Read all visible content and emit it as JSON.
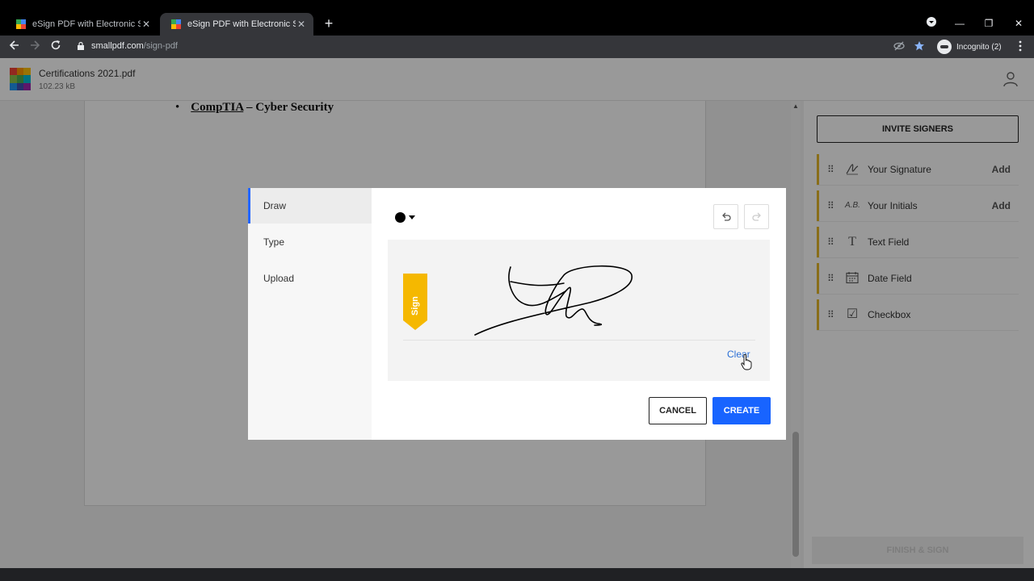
{
  "browser": {
    "tabs": [
      {
        "title": "eSign PDF with Electronic Signatu",
        "close": "✕"
      },
      {
        "title": "eSign PDF with Electronic Signatu",
        "close": "✕"
      }
    ],
    "new_tab": "+",
    "url_host": "smallpdf.com",
    "url_path": "/sign-pdf",
    "incognito_label": "Incognito (2)",
    "window_controls": {
      "minimize": "—",
      "restore": "❐",
      "close": "✕"
    }
  },
  "header": {
    "file_name": "Certifications 2021.pdf",
    "file_size": "102.23 kB",
    "logo_colors": [
      "#f44336",
      "#ff9800",
      "#ffc107",
      "#8bc34a",
      "#4caf50",
      "#00bcd4",
      "#2196f3",
      "#3f51b5",
      "#9c27b0"
    ]
  },
  "document": {
    "bullet": "•",
    "line_underlined": "CompTIA",
    "line_rest": " – Cyber Security"
  },
  "side_panel": {
    "invite_label": "INVITE SIGNERS",
    "fields": [
      {
        "label": "Your Signature",
        "icon": "signature-icon",
        "add": "Add"
      },
      {
        "label": "Your Initials",
        "icon": "initials-icon",
        "add": "Add"
      },
      {
        "label": "Text Field",
        "icon": "text-icon",
        "add": ""
      },
      {
        "label": "Date Field",
        "icon": "calendar-icon",
        "add": ""
      },
      {
        "label": "Checkbox",
        "icon": "checkbox-icon",
        "add": ""
      }
    ],
    "initials_glyph": "A.B.",
    "text_glyph": "T",
    "checkbox_glyph": "☑",
    "finish_label": "FINISH & SIGN",
    "accent": "#e5b82a"
  },
  "modal": {
    "tabs": [
      "Draw",
      "Type",
      "Upload"
    ],
    "active_tab": "Draw",
    "pen_color": "#000000",
    "sign_tag_label": "Sign",
    "clear_label": "Clear",
    "cancel_label": "CANCEL",
    "create_label": "CREATE",
    "primary_color": "#1864ff"
  }
}
